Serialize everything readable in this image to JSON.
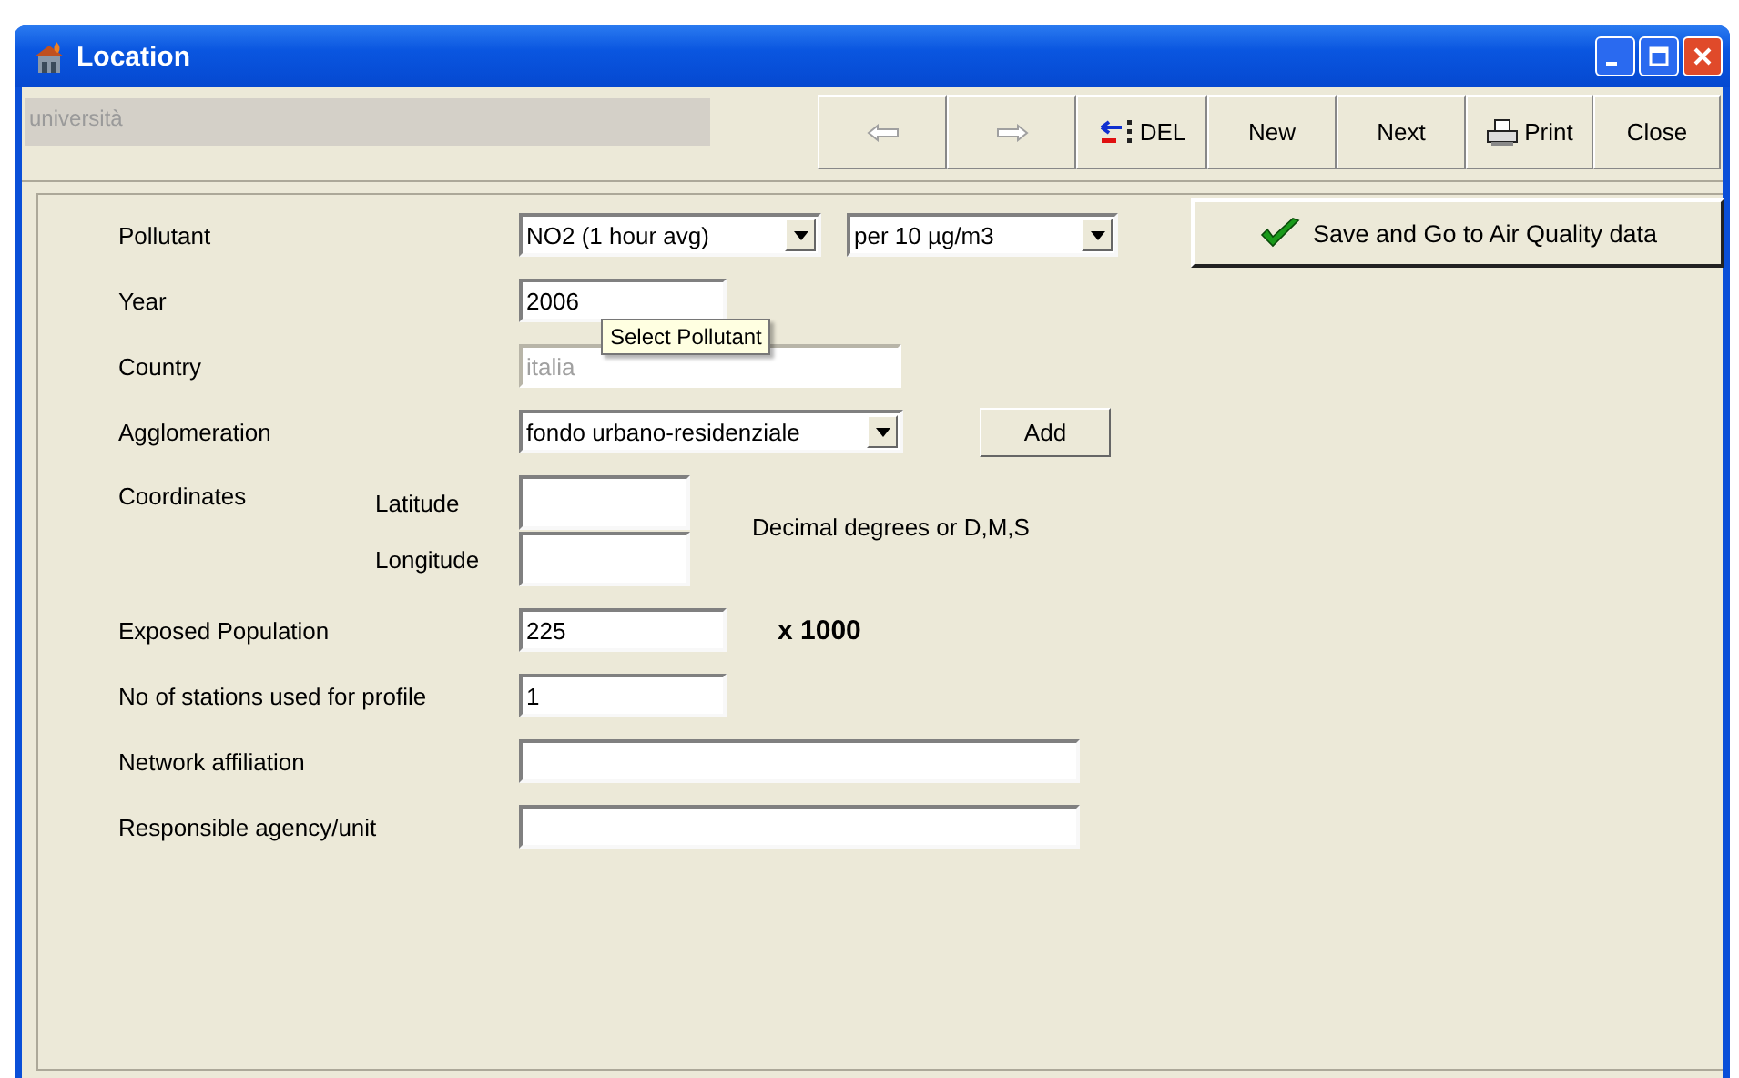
{
  "window": {
    "title": "Location"
  },
  "record_field": {
    "value": "università",
    "disabled": true
  },
  "toolbar": [
    {
      "kind": "prev",
      "disabled": true
    },
    {
      "kind": "next-arrow",
      "disabled": true
    },
    {
      "kind": "delete",
      "label": "DEL",
      "disabled": false
    },
    {
      "kind": "text",
      "label": "New",
      "disabled": false
    },
    {
      "kind": "text",
      "label": "Next",
      "disabled": false
    },
    {
      "kind": "print",
      "label": "Print",
      "disabled": false
    },
    {
      "kind": "text",
      "label": "Close",
      "disabled": false
    }
  ],
  "save_button": {
    "label": "Save and Go to Air Quality data"
  },
  "rows": [
    {
      "kind": "pollutant",
      "label": "Pollutant",
      "select": "NO2 (1 hour avg)",
      "unit_select": "per 10 µg/m3"
    },
    {
      "kind": "text-short",
      "label": "Year",
      "value": "2006",
      "disabled": false
    },
    {
      "kind": "text-medium",
      "label": "Country",
      "value": "italia",
      "disabled": true
    },
    {
      "kind": "agglomeration",
      "label": "Agglomeration",
      "select": "fondo urbano-residenziale",
      "button": "Add"
    },
    {
      "kind": "coordinates",
      "label": "Coordinates",
      "fields": [
        {
          "label": "Latitude"
        },
        {
          "label": "Longitude"
        }
      ],
      "hint": "Decimal degrees or D,M,S"
    },
    {
      "kind": "text-short",
      "label": "Exposed Population",
      "value": "225",
      "disabled": false,
      "suffix": "x 1000"
    },
    {
      "kind": "text-short",
      "label": "No of stations used for profile",
      "value": "1",
      "disabled": false
    },
    {
      "kind": "text-long",
      "label": "Network affiliation",
      "disabled": false
    },
    {
      "kind": "text-long",
      "label": "Responsible agency/unit",
      "disabled": false
    }
  ],
  "tooltip": {
    "text": "Select Pollutant"
  }
}
